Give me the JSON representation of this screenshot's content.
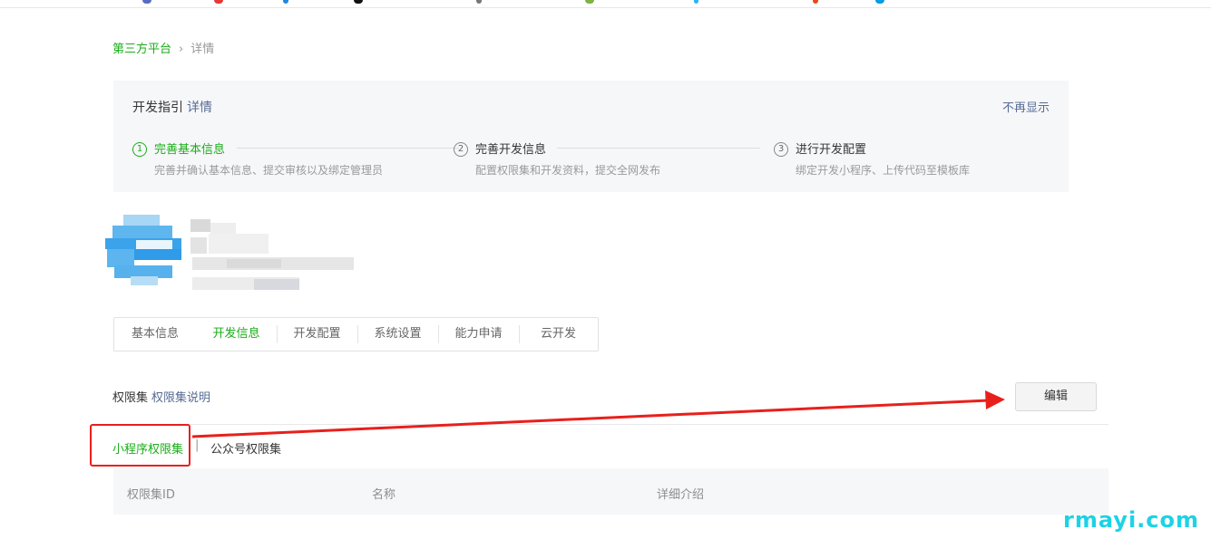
{
  "breadcrumb": {
    "parent": "第三方平台",
    "separator": "›",
    "current": "详情"
  },
  "guide": {
    "title": "开发指引",
    "detail_link": "详情",
    "dismiss": "不再显示",
    "steps": [
      {
        "num": "1",
        "label": "完善基本信息",
        "desc": "完善并确认基本信息、提交审核以及绑定管理员"
      },
      {
        "num": "2",
        "label": "完善开发信息",
        "desc": "配置权限集和开发资料，提交全网发布"
      },
      {
        "num": "3",
        "label": "进行开发配置",
        "desc": "绑定开发小程序、上传代码至模板库"
      }
    ]
  },
  "tabs": [
    "基本信息",
    "开发信息",
    "开发配置",
    "系统设置",
    "能力申请",
    "云开发"
  ],
  "permissions": {
    "title": "权限集",
    "help_link": "权限集说明",
    "edit_button": "编辑",
    "subtabs": [
      "小程序权限集",
      "公众号权限集"
    ],
    "subtab_separator": "|",
    "columns": [
      "权限集ID",
      "名称",
      "详细介绍"
    ]
  },
  "watermark": "rmayi.com",
  "colors": {
    "accent": "#1aad19",
    "link": "#576b95",
    "annotation": "#e8201c",
    "watermark": "#1ed2e6"
  }
}
